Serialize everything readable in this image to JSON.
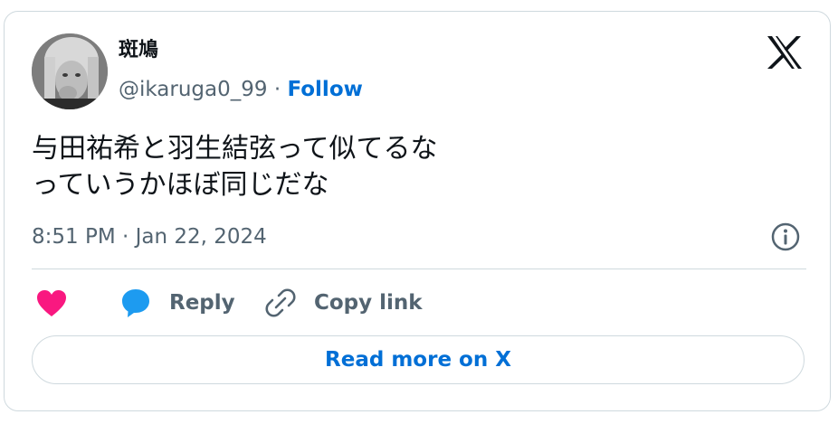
{
  "user": {
    "display_name": "斑鳩",
    "handle": "@ikaruga0_99",
    "separator": "·",
    "follow_label": "Follow"
  },
  "tweet": {
    "line1": "与田祐希と羽生結弦って似てるな",
    "line2": "っていうかほぼ同じだな",
    "timestamp": "8:51 PM · Jan 22, 2024"
  },
  "actions": {
    "reply_label": "Reply",
    "copy_label": "Copy link",
    "read_more_label": "Read more on X"
  },
  "colors": {
    "accent": "#006fd6",
    "heart": "#f91880",
    "reply_bubble": "#1d9bf0",
    "secondary_text": "#536471",
    "primary_text": "#0f1419",
    "border": "#cfd9de"
  },
  "icons": {
    "brand": "x-logo-icon",
    "info": "info-icon",
    "like": "heart-icon",
    "reply": "speech-bubble-icon",
    "copy": "link-icon"
  }
}
